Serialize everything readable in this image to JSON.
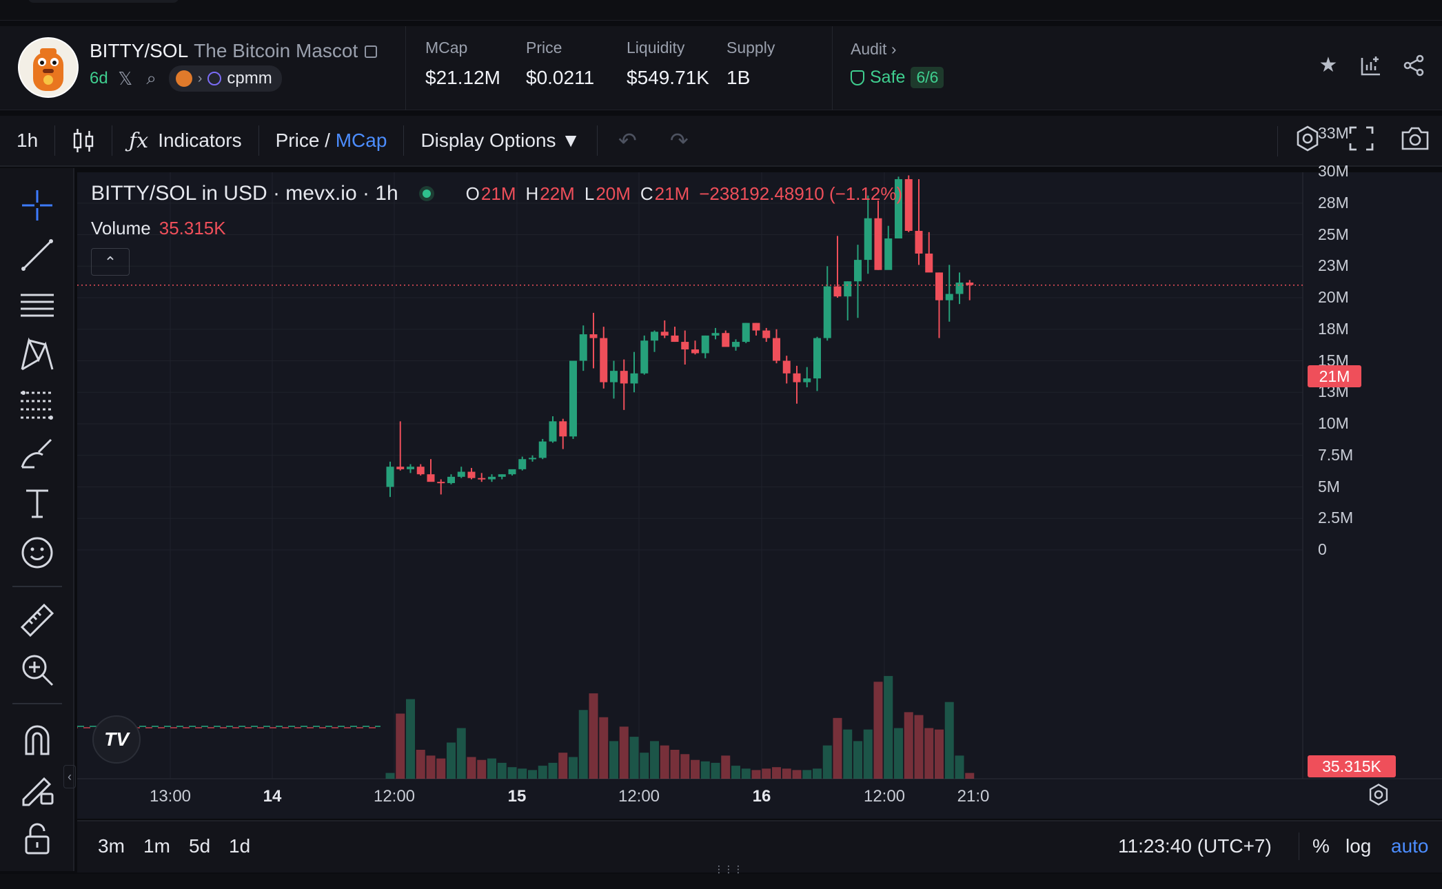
{
  "header": {
    "symbol": "BITTY/SOL",
    "name": "The Bitcoin Mascot",
    "age": "6d",
    "dex": "cpmm",
    "stats": [
      {
        "label": "MCap",
        "value": "$21.12M"
      },
      {
        "label": "Price",
        "value": "$0.0211"
      },
      {
        "label": "Liquidity",
        "value": "$549.71K"
      },
      {
        "label": "Supply",
        "value": "1B"
      }
    ],
    "audit": {
      "label": "Audit",
      "status": "Safe",
      "score": "6/6"
    }
  },
  "toolbar": {
    "interval": "1h",
    "indicators": "Indicators",
    "price_label": "Price",
    "slash": " / ",
    "mcap_label": "MCap",
    "display_options": "Display Options ▼"
  },
  "chart": {
    "legend": {
      "title": "BITTY/SOL in USD · mevx.io · 1h",
      "open_k": "O",
      "open": "21M",
      "high_k": "H",
      "high": "22M",
      "low_k": "L",
      "low": "20M",
      "close_k": "C",
      "close": "21M",
      "change": "−238192.48910 (−1.12%)",
      "volume_label": "Volume",
      "volume_value": "35.315K"
    },
    "last_price_tag": "21M",
    "last_volume_tag": "35.315K",
    "y_ticks": [
      "33M",
      "30M",
      "28M",
      "25M",
      "23M",
      "20M",
      "18M",
      "15M",
      "13M",
      "10M",
      "7.5M",
      "5M",
      "2.5M",
      "0"
    ],
    "x_ticks": [
      {
        "label": "13:00",
        "bold": false
      },
      {
        "label": "14",
        "bold": true
      },
      {
        "label": "12:00",
        "bold": false
      },
      {
        "label": "15",
        "bold": true
      },
      {
        "label": "12:00",
        "bold": false
      },
      {
        "label": "16",
        "bold": true
      },
      {
        "label": "12:00",
        "bold": false
      },
      {
        "label": "21:0",
        "bold": false
      }
    ]
  },
  "bottom": {
    "ranges": [
      "3m",
      "1m",
      "5d",
      "1d"
    ],
    "clock": "11:23:40 (UTC+7)",
    "percent": "%",
    "log": "log",
    "auto": "auto"
  },
  "colors": {
    "up": "#26a17b",
    "down": "#ef4f5a",
    "accent": "#4c8dff",
    "safe": "#3fce8f"
  },
  "chart_data": {
    "type": "candlestick",
    "interval": "1h",
    "ohlc_note": "values in market cap USD millions, read off price axis",
    "candles": [
      [
        5.0,
        7.0,
        4.2,
        6.6
      ],
      [
        6.6,
        10.2,
        6.3,
        6.4
      ],
      [
        6.4,
        6.8,
        6.1,
        6.6
      ],
      [
        6.6,
        6.8,
        5.9,
        6.0
      ],
      [
        6.0,
        7.2,
        5.8,
        5.4
      ],
      [
        5.4,
        5.6,
        4.4,
        5.3
      ],
      [
        5.3,
        6.0,
        5.2,
        5.8
      ],
      [
        5.8,
        6.6,
        5.7,
        6.2
      ],
      [
        6.2,
        6.5,
        5.6,
        5.7
      ],
      [
        5.7,
        6.1,
        5.4,
        5.6
      ],
      [
        5.6,
        6.0,
        5.4,
        5.8
      ],
      [
        5.8,
        6.0,
        5.6,
        6.0
      ],
      [
        6.0,
        6.3,
        5.9,
        6.4
      ],
      [
        6.4,
        7.4,
        6.3,
        7.2
      ],
      [
        7.2,
        7.5,
        7.0,
        7.3
      ],
      [
        7.3,
        8.8,
        7.2,
        8.6
      ],
      [
        8.6,
        10.6,
        8.5,
        10.2
      ],
      [
        10.2,
        10.4,
        8.0,
        9.0
      ],
      [
        9.0,
        15.0,
        8.8,
        15.0
      ],
      [
        15.0,
        17.8,
        14.2,
        17.1
      ],
      [
        17.1,
        18.8,
        14.4,
        16.8
      ],
      [
        16.8,
        17.7,
        12.8,
        13.3
      ],
      [
        13.3,
        15.0,
        12.0,
        14.2
      ],
      [
        14.2,
        15.1,
        11.1,
        13.2
      ],
      [
        13.2,
        15.7,
        12.5,
        14.0
      ],
      [
        14.0,
        17.0,
        13.9,
        16.6
      ],
      [
        16.6,
        17.4,
        15.7,
        17.3
      ],
      [
        17.3,
        18.2,
        16.8,
        17.0
      ],
      [
        17.0,
        17.7,
        16.5,
        16.5
      ],
      [
        16.5,
        17.4,
        14.7,
        15.9
      ],
      [
        15.9,
        16.6,
        15.5,
        15.6
      ],
      [
        15.6,
        17.0,
        15.2,
        17.0
      ],
      [
        17.0,
        17.6,
        16.7,
        17.2
      ],
      [
        17.2,
        17.4,
        16.5,
        16.1
      ],
      [
        16.1,
        16.7,
        15.8,
        16.5
      ],
      [
        16.5,
        18.0,
        16.4,
        18.0
      ],
      [
        18.0,
        18.0,
        17.0,
        17.4
      ],
      [
        17.4,
        17.6,
        16.5,
        16.8
      ],
      [
        16.8,
        17.5,
        14.8,
        15.0
      ],
      [
        15.0,
        15.4,
        13.2,
        14.0
      ],
      [
        14.0,
        14.6,
        11.6,
        13.3
      ],
      [
        13.3,
        14.5,
        12.9,
        13.6
      ],
      [
        13.6,
        16.9,
        12.6,
        16.8
      ],
      [
        16.8,
        22.5,
        16.6,
        20.9
      ],
      [
        20.9,
        24.9,
        20.0,
        20.1
      ],
      [
        20.1,
        21.3,
        18.2,
        21.3
      ],
      [
        21.3,
        24.2,
        18.4,
        23.0
      ],
      [
        23.0,
        28.1,
        21.9,
        26.3
      ],
      [
        26.3,
        27.7,
        22.2,
        22.2
      ],
      [
        22.2,
        25.7,
        22.3,
        24.7
      ],
      [
        24.7,
        29.6,
        24.7,
        29.4
      ],
      [
        29.4,
        29.7,
        25.2,
        25.3
      ],
      [
        25.3,
        29.4,
        22.6,
        23.5
      ],
      [
        23.5,
        25.2,
        22.1,
        22.0
      ],
      [
        22.0,
        22.0,
        16.8,
        19.8
      ],
      [
        19.8,
        22.6,
        18.1,
        20.3
      ],
      [
        20.3,
        22.0,
        19.5,
        21.2
      ],
      [
        21.2,
        21.4,
        19.8,
        21.0
      ]
    ],
    "volume_label": "Volume",
    "last_volume": "35.315K",
    "ylim": [
      0,
      33
    ],
    "y_unit": "M"
  }
}
